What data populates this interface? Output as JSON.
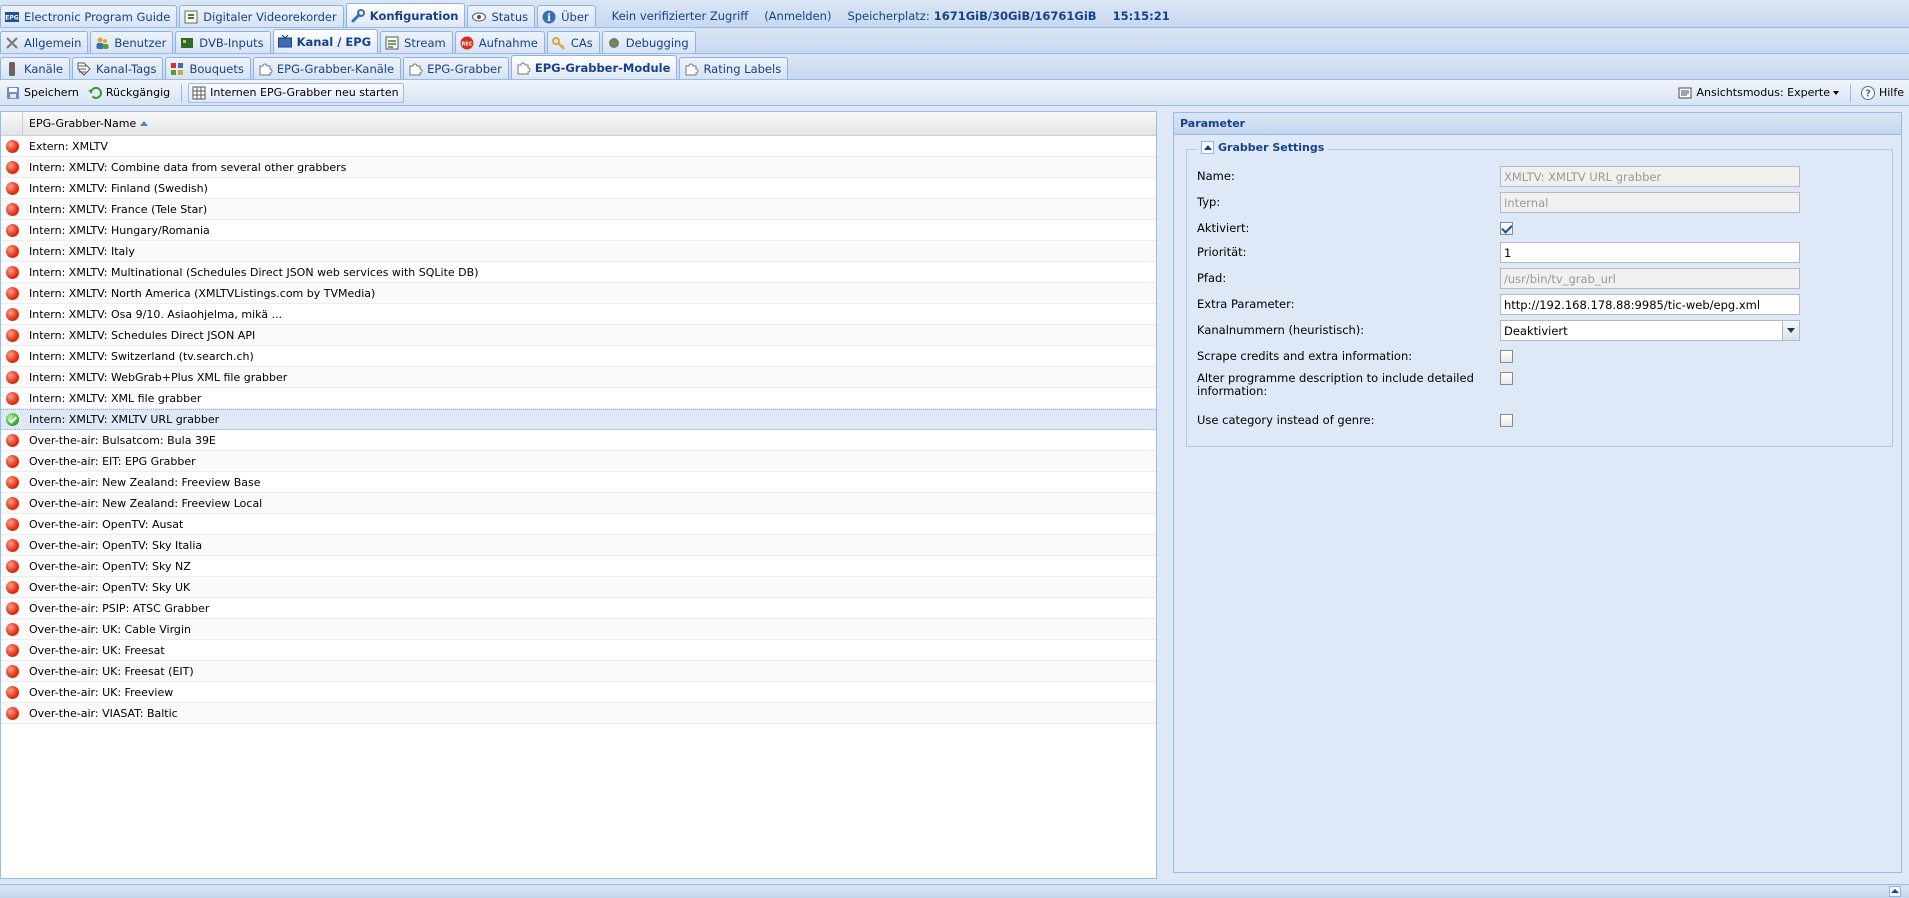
{
  "tabs_row1": [
    {
      "label": "Electronic Program Guide",
      "icon": "epg-icon"
    },
    {
      "label": "Digitaler Videorekorder",
      "icon": "recorder-icon"
    },
    {
      "label": "Konfiguration",
      "icon": "wrench-icon",
      "active": true
    },
    {
      "label": "Status",
      "icon": "eye-icon"
    },
    {
      "label": "Über",
      "icon": "info-icon"
    }
  ],
  "status": {
    "access": "Kein verifizierter Zugriff",
    "login": "(Anmelden)",
    "storage_label": "Speicherplatz:",
    "storage_value": "1671GiB/30GiB/16761GiB",
    "time": "15:15:21"
  },
  "tabs_row2": [
    {
      "label": "Allgemein",
      "icon": "tools-icon"
    },
    {
      "label": "Benutzer",
      "icon": "users-icon"
    },
    {
      "label": "DVB-Inputs",
      "icon": "card-icon"
    },
    {
      "label": "Kanal / EPG",
      "icon": "tv-icon",
      "active": true
    },
    {
      "label": "Stream",
      "icon": "stream-icon"
    },
    {
      "label": "Aufnahme",
      "icon": "record-icon"
    },
    {
      "label": "CAs",
      "icon": "key-icon"
    },
    {
      "label": "Debugging",
      "icon": "bug-icon"
    }
  ],
  "tabs_row3": [
    {
      "label": "Kanäle",
      "icon": "remote-icon"
    },
    {
      "label": "Kanal-Tags",
      "icon": "tag-icon"
    },
    {
      "label": "Bouquets",
      "icon": "grid-icon"
    },
    {
      "label": "EPG-Grabber-Kanäle",
      "icon": "puzzle-icon"
    },
    {
      "label": "EPG-Grabber",
      "icon": "puzzle-icon"
    },
    {
      "label": "EPG-Grabber-Module",
      "icon": "puzzle-icon",
      "active": true
    },
    {
      "label": "Rating Labels",
      "icon": "puzzle-icon"
    }
  ],
  "toolbar": {
    "save": "Speichern",
    "undo": "Rückgängig",
    "restart": "Internen EPG-Grabber neu starten",
    "view_mode": "Ansichtsmodus: Experte",
    "help": "Hilfe"
  },
  "grid": {
    "column": "EPG-Grabber-Name",
    "rows": [
      {
        "name": "Extern: XMLTV",
        "status": "off"
      },
      {
        "name": "Intern: XMLTV: Combine data from several other grabbers",
        "status": "off"
      },
      {
        "name": "Intern: XMLTV: Finland (Swedish)",
        "status": "off"
      },
      {
        "name": "Intern: XMLTV: France (Tele Star)",
        "status": "off"
      },
      {
        "name": "Intern: XMLTV: Hungary/Romania",
        "status": "off"
      },
      {
        "name": "Intern: XMLTV: Italy",
        "status": "off"
      },
      {
        "name": "Intern: XMLTV: Multinational (Schedules Direct JSON web services with SQLite DB)",
        "status": "off"
      },
      {
        "name": "Intern: XMLTV: North America (XMLTVListings.com by TVMedia)",
        "status": "off"
      },
      {
        "name": "Intern: XMLTV: Osa 9/10. Asiaohjelma, mikä ...",
        "status": "off"
      },
      {
        "name": "Intern: XMLTV: Schedules Direct JSON API",
        "status": "off"
      },
      {
        "name": "Intern: XMLTV: Switzerland (tv.search.ch)",
        "status": "off"
      },
      {
        "name": "Intern: XMLTV: WebGrab+Plus XML file grabber",
        "status": "off"
      },
      {
        "name": "Intern: XMLTV: XML file grabber",
        "status": "off"
      },
      {
        "name": "Intern: XMLTV: XMLTV URL grabber",
        "status": "on",
        "selected": true
      },
      {
        "name": "Over-the-air: Bulsatcom: Bula 39E",
        "status": "off"
      },
      {
        "name": "Over-the-air: EIT: EPG Grabber",
        "status": "off"
      },
      {
        "name": "Over-the-air: New Zealand: Freeview Base",
        "status": "off"
      },
      {
        "name": "Over-the-air: New Zealand: Freeview Local",
        "status": "off"
      },
      {
        "name": "Over-the-air: OpenTV: Ausat",
        "status": "off"
      },
      {
        "name": "Over-the-air: OpenTV: Sky Italia",
        "status": "off"
      },
      {
        "name": "Over-the-air: OpenTV: Sky NZ",
        "status": "off"
      },
      {
        "name": "Over-the-air: OpenTV: Sky UK",
        "status": "off"
      },
      {
        "name": "Over-the-air: PSIP: ATSC Grabber",
        "status": "off"
      },
      {
        "name": "Over-the-air: UK: Cable Virgin",
        "status": "off"
      },
      {
        "name": "Over-the-air: UK: Freesat",
        "status": "off"
      },
      {
        "name": "Over-the-air: UK: Freesat (EIT)",
        "status": "off"
      },
      {
        "name": "Over-the-air: UK: Freeview",
        "status": "off"
      },
      {
        "name": "Over-the-air: VIASAT: Baltic",
        "status": "off"
      }
    ]
  },
  "param": {
    "title": "Parameter",
    "group": "Grabber Settings",
    "name_label": "Name:",
    "name_value": "XMLTV: XMLTV URL grabber",
    "type_label": "Typ:",
    "type_value": "Internal",
    "enabled_label": "Aktiviert:",
    "enabled": true,
    "priority_label": "Priorität:",
    "priority_value": "1",
    "path_label": "Pfad:",
    "path_value": "/usr/bin/tv_grab_url",
    "extra_label": "Extra Parameter:",
    "extra_value": "http://192.168.178.88:9985/tic-web/epg.xml",
    "channel_numbers_label": "Kanalnummern (heuristisch):",
    "channel_numbers_value": "Deaktiviert",
    "scrape_label": "Scrape credits and extra information:",
    "alter_label": "Alter programme description to include detailed information:",
    "category_label": "Use category instead of genre:"
  }
}
